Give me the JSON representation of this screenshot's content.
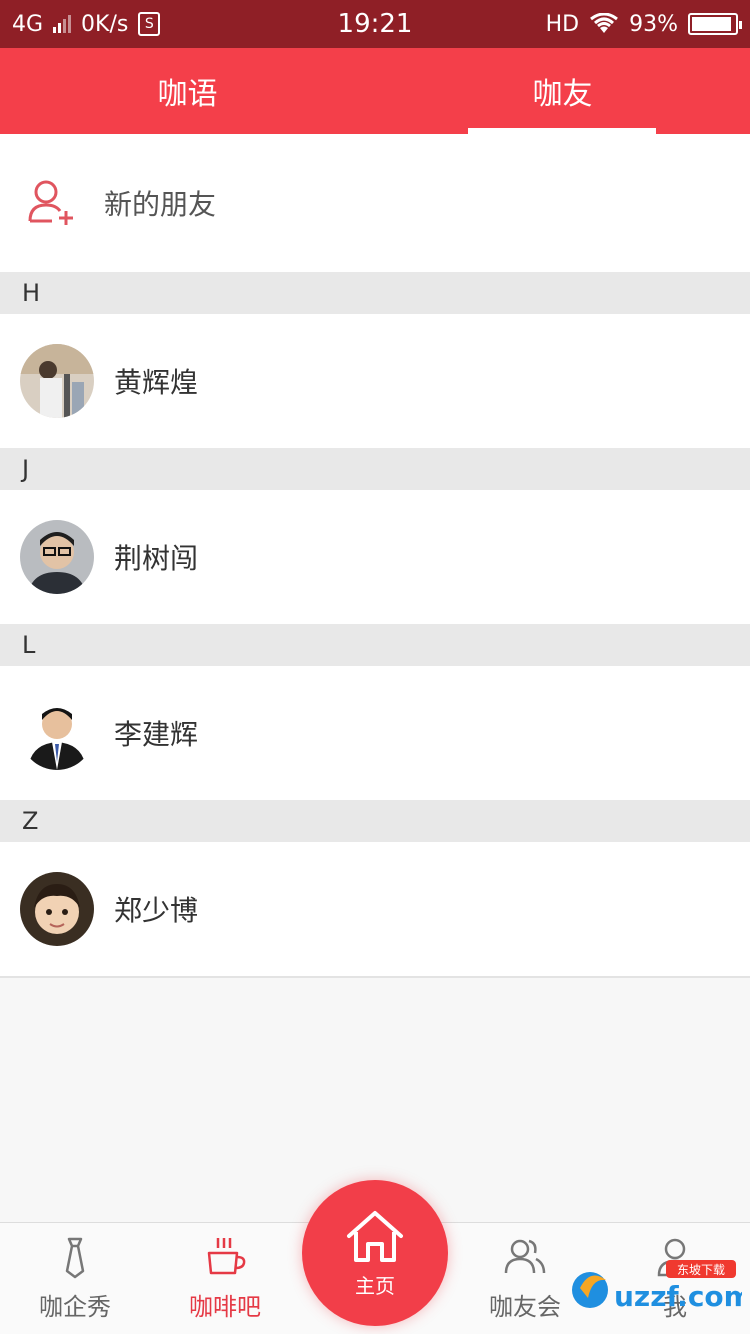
{
  "status_bar": {
    "network": "4G",
    "speed": "0K/s",
    "sim_badge": "S",
    "time": "19:21",
    "hd": "HD",
    "battery": "93%",
    "battery_level": 0.93
  },
  "top_tabs": [
    {
      "label": "咖语",
      "active": false
    },
    {
      "label": "咖友",
      "active": true
    }
  ],
  "new_friend": {
    "label": "新的朋友",
    "icon": "add-user-icon"
  },
  "sections": [
    {
      "letter": "H",
      "contacts": [
        {
          "name": "黄辉煌"
        }
      ]
    },
    {
      "letter": "J",
      "contacts": [
        {
          "name": "荆树闯"
        }
      ]
    },
    {
      "letter": "L",
      "contacts": [
        {
          "name": "李建辉"
        }
      ]
    },
    {
      "letter": "Z",
      "contacts": [
        {
          "name": "郑少博"
        }
      ]
    }
  ],
  "bottom_nav": {
    "items": [
      {
        "label": "咖企秀",
        "icon": "tie-icon",
        "active": false
      },
      {
        "label": "咖啡吧",
        "icon": "coffee-cup-icon",
        "active": true
      },
      {
        "label": "咖友会",
        "icon": "users-icon",
        "active": false
      },
      {
        "label": "我",
        "icon": "person-icon",
        "active": false
      }
    ],
    "home": {
      "label": "主页",
      "icon": "home-icon"
    }
  },
  "watermark": {
    "text": "uzzf.com",
    "badge": "东坡下载"
  },
  "colors": {
    "status_bar": "#8f1f26",
    "brand_red": "#f43f4a",
    "active_nav": "#e53945"
  }
}
